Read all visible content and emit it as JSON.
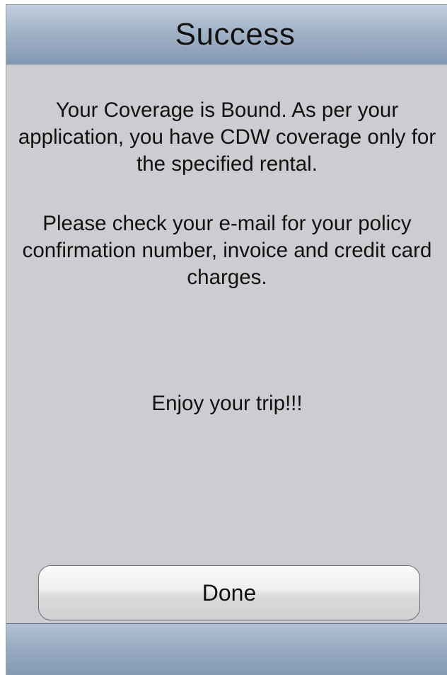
{
  "header": {
    "title": "Success"
  },
  "message": {
    "paragraph_1": "Your Coverage is Bound. As per your application, you have CDW coverage only for the specified rental.",
    "paragraph_2": "Please check your e-mail for your policy confirmation number, invoice and credit card charges.",
    "paragraph_3": "Enjoy your trip!!!"
  },
  "actions": {
    "done_label": "Done"
  },
  "colors": {
    "background": "#cdcdd1",
    "bar_top": "#c3cfdd",
    "bar_bottom": "#8499b3"
  }
}
